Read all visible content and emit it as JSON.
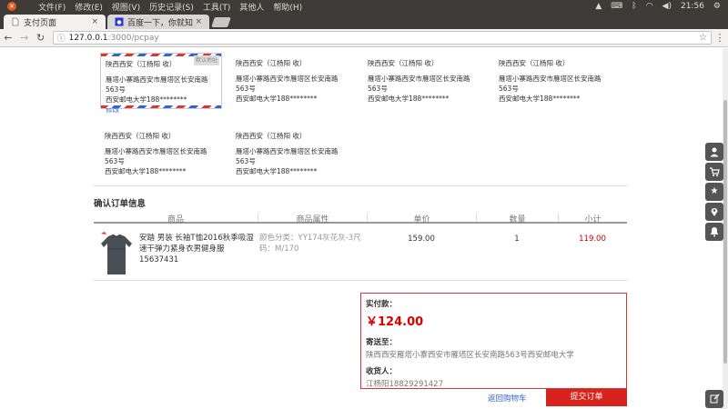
{
  "os": {
    "menu": [
      "文件(F)",
      "修改(E)",
      "视图(V)",
      "历史记录(S)",
      "工具(T)",
      "其他人",
      "帮助(H)"
    ],
    "time": "21:56",
    "tray_icons": [
      "battery-icon",
      "bluetooth-icon",
      "wifi-icon",
      "volume-icon",
      "settings-icon"
    ]
  },
  "browser": {
    "tabs": [
      {
        "label": "支付页面",
        "active": true
      },
      {
        "label": "百度一下，你就知",
        "active": false
      }
    ],
    "url_host": "127.0.0.1",
    "url_path": ":3000/pcpay"
  },
  "addresses": {
    "default_tag": "默认地址",
    "edit_label": "修改",
    "items": [
      {
        "title": "陕西西安（江杨阳 收）",
        "line1": "雁塔小寨路西安市雁塔区长安南路563号",
        "line2": "西安邮电大学188********"
      },
      {
        "title": "陕西西安（江杨阳 收）",
        "line1": "雁塔小寨路西安市雁塔区长安南路563号",
        "line2": "西安邮电大学188********"
      },
      {
        "title": "陕西西安（江杨阳 收）",
        "line1": "雁塔小寨路西安市雁塔区长安南路563号",
        "line2": "西安邮电大学188********"
      },
      {
        "title": "陕西西安（江杨阳 收）",
        "line1": "雁塔小寨路西安市雁塔区长安南路563号",
        "line2": "西安邮电大学188********"
      },
      {
        "title": "陕西西安（江杨阳 收）",
        "line1": "雁塔小寨路西安市雁塔区长安南路563号",
        "line2": "西安邮电大学188********"
      },
      {
        "title": "陕西西安（江杨阳 收）",
        "line1": "雁塔小寨路西安市雁塔区长安南路563号",
        "line2": "西安邮电大学188********"
      }
    ]
  },
  "order": {
    "section_title": "确认订单信息",
    "headers": [
      "商品",
      "商品属性",
      "单价",
      "数量",
      "小计"
    ],
    "item": {
      "name": "安踏 男装 长袖T恤2016秋季吸湿速干弹力紧身衣男健身服 15637431",
      "attr": "颜色分类：YY174灰花灰-3尺码：M/170",
      "price": "159.00",
      "qty": "1",
      "subtotal": "119.00"
    }
  },
  "summary": {
    "pay_label": "实付款：",
    "amount": "￥124.00",
    "ship_label": "寄送至：",
    "ship_to": "陕西西安雁塔小寨西安市雁塔区长安南路563号西安邮电大学",
    "recv_label": "收货人：",
    "receiver": "江杨阳18829291427"
  },
  "actions": {
    "back": "返回购物车",
    "submit": "提交订单"
  },
  "sidebar": {
    "buttons": [
      "user-icon",
      "cart-icon",
      "star-icon",
      "location-icon",
      "bell-icon",
      "edit-icon"
    ]
  },
  "colors": {
    "accent_red": "#d8231c",
    "link_blue": "#3366cc"
  }
}
